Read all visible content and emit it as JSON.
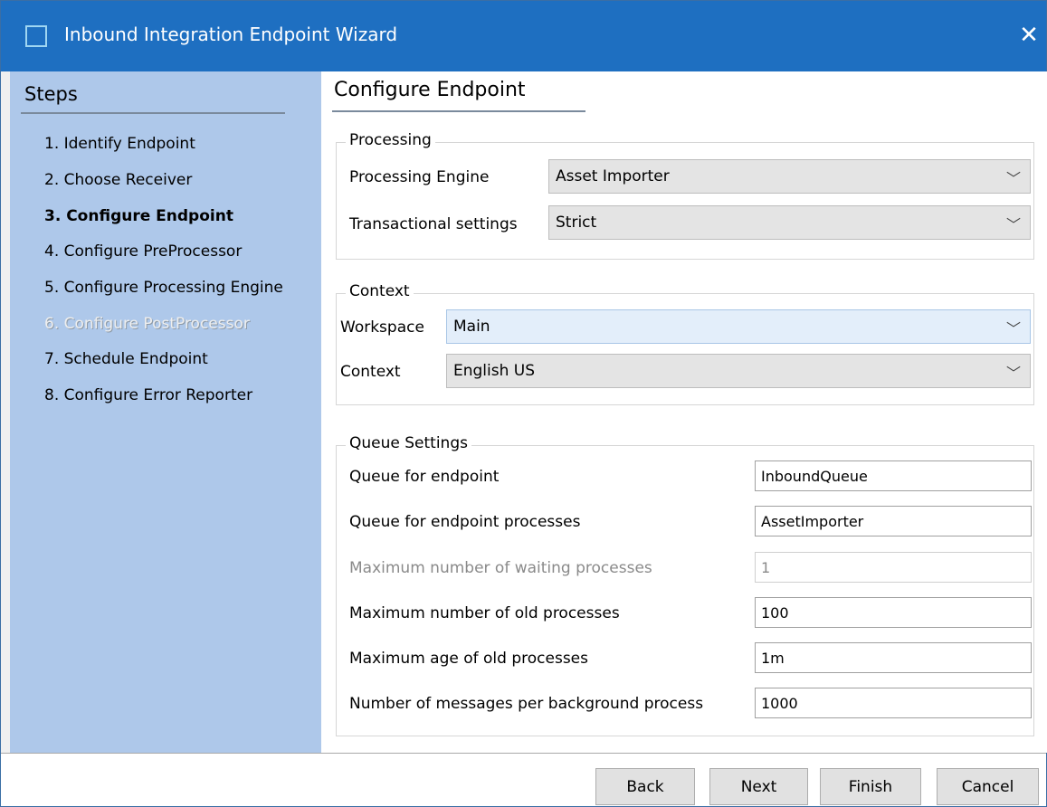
{
  "window": {
    "title": "Inbound Integration Endpoint Wizard",
    "close_glyph": "✕"
  },
  "sidebar": {
    "title": "Steps",
    "steps": [
      {
        "label": "1. Identify Endpoint",
        "state": "normal"
      },
      {
        "label": "2. Choose Receiver",
        "state": "normal"
      },
      {
        "label": "3. Configure Endpoint",
        "state": "current"
      },
      {
        "label": "4. Configure PreProcessor",
        "state": "normal"
      },
      {
        "label": "5. Configure Processing Engine",
        "state": "normal"
      },
      {
        "label": "6. Configure PostProcessor",
        "state": "disabled"
      },
      {
        "label": "7. Schedule Endpoint",
        "state": "normal"
      },
      {
        "label": "8. Configure Error Reporter",
        "state": "normal"
      }
    ]
  },
  "page": {
    "title": "Configure Endpoint"
  },
  "processing": {
    "legend": "Processing",
    "engine_label": "Processing Engine",
    "engine_value": "Asset Importer",
    "transactional_label": "Transactional settings",
    "transactional_value": "Strict"
  },
  "context": {
    "legend": "Context",
    "workspace_label": "Workspace",
    "workspace_value": "Main",
    "context_label": "Context",
    "context_value": "English US"
  },
  "queue": {
    "legend": "Queue Settings",
    "rows": [
      {
        "label": "Queue for endpoint",
        "value": "InboundQueue",
        "enabled": true
      },
      {
        "label": "Queue for endpoint processes",
        "value": "AssetImporter",
        "enabled": true
      },
      {
        "label": "Maximum number of waiting processes",
        "value": "1",
        "enabled": false
      },
      {
        "label": "Maximum number of old processes",
        "value": "100",
        "enabled": true
      },
      {
        "label": "Maximum age of old processes",
        "value": "1m",
        "enabled": true
      },
      {
        "label": "Number of messages per background process",
        "value": "1000",
        "enabled": true
      }
    ]
  },
  "buttons": {
    "back": "Back",
    "next": "Next",
    "finish": "Finish",
    "cancel": "Cancel"
  },
  "icons": {
    "chevron": "﹀",
    "window_icon": "app-window-icon",
    "close": "close-icon"
  },
  "colors": {
    "titlebar": "#1e6fc1",
    "sidebar": "#aec8ea",
    "focused_combo": "#e3eefa"
  }
}
